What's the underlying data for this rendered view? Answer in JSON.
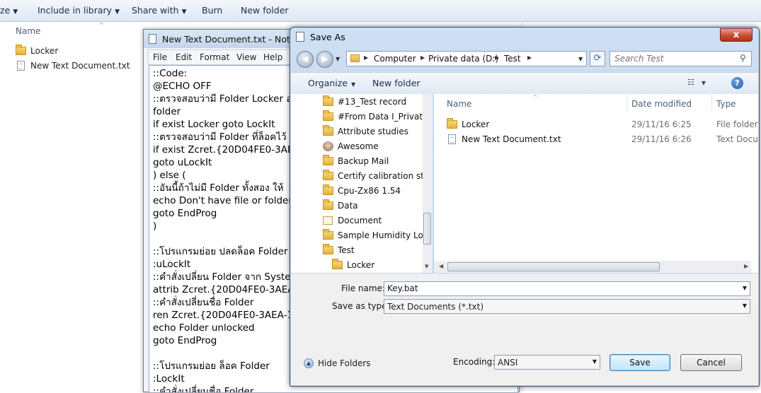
{
  "explorer": {
    "toolbar": {
      "organize_partial": "ze",
      "include_in_library": "Include in library",
      "share_with": "Share with",
      "burn": "Burn",
      "new_folder": "New folder"
    },
    "column_name": "Name",
    "items": [
      {
        "name": "Locker",
        "icon": "folder-icon"
      },
      {
        "name": "New Text Document.txt",
        "icon": "text-file-icon"
      }
    ]
  },
  "notepad": {
    "title": "New Text Document.txt - Notepad",
    "menu": [
      "File",
      "Edit",
      "Format",
      "View",
      "Help"
    ],
    "content": "::Code:\n@ECHO OFF\n::ตรวจสอบว่ามี Folder Locker อยู่\nfolder\nif exist Locker goto LockIt\n::ตรวจสอบว่ามี Folder ที่ล็อคไว้\nif exist Zcret.{20D04FE0-3AEA-\ngoto uLockIt\n) else (\n::อันนี้ถ้าไม่มี Folder ทั้งสอง ให้\necho Don't have file or folder\ngoto EndProg\n)\n\n::โปรแกรมย่อย ปลดล็อค Folder\n:uLockIt\n::คำสั่งเปลี่ยน Folder จาก System\nattrib Zcret.{20D04FE0-3AEA-\n::คำสั่งเปลี่ยนชื่อ Folder\nren Zcret.{20D04FE0-3AEA-10\necho Folder unlocked\ngoto EndProg\n\n::โปรแกรมย่อย ล็อค Folder\n:LockIt\n::คำสั่งเปลี่ยนชื่อ Folder"
  },
  "dialog": {
    "title": "Save As",
    "close_label": "x",
    "breadcrumb": [
      "Computer",
      "Private data (D:)",
      "Test"
    ],
    "search_placeholder": "Search Test",
    "organize": "Organize",
    "new_folder": "New folder",
    "help_label": "?",
    "tree": [
      {
        "name": "#13_Test record",
        "icon": "folder-icon"
      },
      {
        "name": "#From Data I_Private",
        "icon": "folder-icon"
      },
      {
        "name": "Attribute studies",
        "icon": "folder-icon"
      },
      {
        "name": "Awesome",
        "icon": "user-icon"
      },
      {
        "name": "Backup Mail",
        "icon": "folder-icon"
      },
      {
        "name": "Certify calibration staff",
        "icon": "folder-icon"
      },
      {
        "name": "Cpu-Zx86 1.54",
        "icon": "folder-icon"
      },
      {
        "name": "Data",
        "icon": "folder-icon"
      },
      {
        "name": "Document",
        "icon": "document-icon"
      },
      {
        "name": "Sample Humidity Logger",
        "icon": "folder-icon"
      },
      {
        "name": "Test",
        "icon": "folder-icon"
      },
      {
        "name": "Locker",
        "icon": "folder-icon"
      }
    ],
    "columns": {
      "name": "Name",
      "date_modified": "Date modified",
      "type": "Type"
    },
    "files": [
      {
        "name": "Locker",
        "date": "29/11/16 6:25",
        "type": "File folder",
        "icon": "folder-icon"
      },
      {
        "name": "New Text Document.txt",
        "date": "29/11/16 6:26",
        "type": "Text Document",
        "icon": "text-file-icon"
      }
    ],
    "file_name_label": "File name:",
    "file_name_value": "Key.bat",
    "save_as_type_label": "Save as type:",
    "save_as_type_value": "Text Documents (*.txt)",
    "hide_folders": "Hide Folders",
    "encoding_label": "Encoding:",
    "encoding_value": "ANSI",
    "save_label": "Save",
    "cancel_label": "Cancel"
  }
}
